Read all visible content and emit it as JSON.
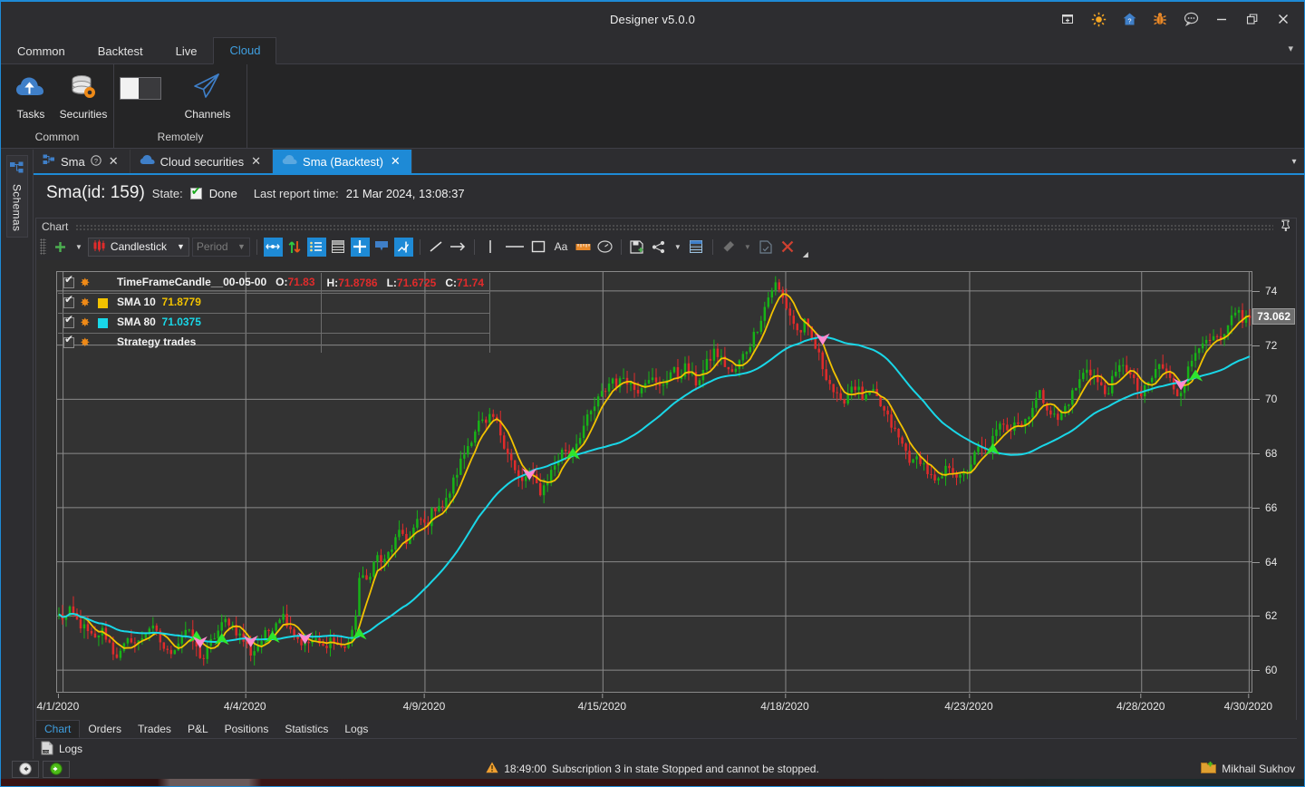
{
  "window": {
    "title": "Designer v5.0.0",
    "icons": [
      {
        "name": "new-window-icon",
        "glyph": "⊞"
      },
      {
        "name": "theme-sun-icon",
        "glyph": "☀"
      },
      {
        "name": "home-help-icon",
        "glyph": "🏠"
      },
      {
        "name": "bug-icon",
        "glyph": "🐞"
      },
      {
        "name": "chat-icon",
        "glyph": "💬"
      },
      {
        "name": "minimize-icon",
        "glyph": "—"
      },
      {
        "name": "restore-icon",
        "glyph": "❐"
      },
      {
        "name": "close-icon",
        "glyph": "✕"
      }
    ]
  },
  "ribbon": {
    "tabs": [
      {
        "label": "Common",
        "active": false
      },
      {
        "label": "Backtest",
        "active": false
      },
      {
        "label": "Live",
        "active": false
      },
      {
        "label": "Cloud",
        "active": true
      }
    ],
    "collapse_glyph": "▾",
    "groups": [
      {
        "name": "Common",
        "buttons": [
          {
            "label": "Tasks",
            "icon": "cloud-upload-icon"
          },
          {
            "label": "Securities",
            "icon": "database-gear-icon"
          }
        ]
      },
      {
        "name": "Remotely",
        "buttons": [
          {
            "label": "",
            "icon": "toggle-switch-icon"
          },
          {
            "label": "Channels",
            "icon": "paper-plane-icon"
          }
        ]
      }
    ]
  },
  "leftdock": {
    "label": "Schemas",
    "icon": "schemas-icon"
  },
  "doctabs": {
    "items": [
      {
        "label": "Sma",
        "icon": "schema-icon",
        "active": false,
        "has_help": true,
        "closable": true
      },
      {
        "label": "Cloud securities",
        "icon": "cloud-icon",
        "active": false,
        "has_help": false,
        "closable": true
      },
      {
        "label": "Sma (Backtest)",
        "icon": "cloud-icon",
        "active": true,
        "has_help": false,
        "closable": true
      }
    ],
    "overflow_glyph": "▾"
  },
  "report": {
    "id_label": "Sma(id: 159)",
    "state_label": "State:",
    "state_value": "Done",
    "report_time_label": "Last report time:",
    "report_time_value": "21 Mar 2024, 13:08:37"
  },
  "chart_panel": {
    "caption": "Chart",
    "pin_glyph": "📌",
    "toolbar": {
      "add_label": "+",
      "chart_type": "Candlestick",
      "period_placeholder": "Period",
      "buttons": [
        {
          "name": "auto-scale-icon",
          "glyph": "⟷",
          "state": "on"
        },
        {
          "name": "updown-arrows-icon",
          "glyph": "⇅",
          "state": "off"
        },
        {
          "name": "legend-list-icon",
          "glyph": "☰",
          "state": "on"
        },
        {
          "name": "data-grid-icon",
          "glyph": "▤",
          "state": "off"
        },
        {
          "name": "crosshair-icon",
          "glyph": "✛",
          "state": "on"
        },
        {
          "name": "tooltip-icon",
          "glyph": "▼",
          "state": "off"
        },
        {
          "name": "measure-icon",
          "glyph": "📐",
          "state": "on"
        },
        {
          "name": "line-tool-icon",
          "glyph": "╱",
          "state": "off"
        },
        {
          "name": "arrow-tool-icon",
          "glyph": "→",
          "state": "off"
        },
        {
          "name": "vertical-line-icon",
          "glyph": "│",
          "state": "off"
        },
        {
          "name": "horizontal-line-icon",
          "glyph": "—",
          "state": "off"
        },
        {
          "name": "rectangle-icon",
          "glyph": "▭",
          "state": "off"
        },
        {
          "name": "text-tool-icon",
          "glyph": "Aa",
          "state": "off"
        },
        {
          "name": "ruler-icon",
          "glyph": "▬",
          "state": "off"
        },
        {
          "name": "gauge-icon",
          "glyph": "◴",
          "state": "off"
        },
        {
          "name": "save-template-icon",
          "glyph": "🖫",
          "state": "off"
        },
        {
          "name": "share-icon",
          "glyph": "⦙",
          "state": "off"
        },
        {
          "name": "grid-rows-icon",
          "glyph": "▤",
          "state": "off"
        },
        {
          "name": "eraser-icon",
          "glyph": "✎",
          "state": "dim"
        },
        {
          "name": "copy-doc-icon",
          "glyph": "🗋",
          "state": "dim"
        },
        {
          "name": "delete-x-icon",
          "glyph": "✕",
          "state": "off"
        }
      ]
    }
  },
  "chart_data": {
    "type": "candlestick",
    "title": "",
    "xlabel": "",
    "ylabel": "",
    "ylim": [
      59.2,
      74.7
    ],
    "yticks": [
      74,
      72,
      70,
      68,
      66,
      64,
      62,
      60
    ],
    "grid": true,
    "xticks": [
      {
        "label": "4/1/2020",
        "pos": 0.005
      },
      {
        "label": "4/4/2020",
        "pos": 0.158
      },
      {
        "label": "4/9/2020",
        "pos": 0.308
      },
      {
        "label": "4/15/2020",
        "pos": 0.457
      },
      {
        "label": "4/18/2020",
        "pos": 0.61
      },
      {
        "label": "4/23/2020",
        "pos": 0.764
      },
      {
        "label": "4/28/2020",
        "pos": 0.908
      },
      {
        "label": "4/30/2020",
        "pos": 0.998
      }
    ],
    "last_price_label": "73.062",
    "last_price": 73.062,
    "legend_position": "top-left",
    "series": [
      {
        "name": "TimeFrameCandle__00-05-00",
        "type": "candlestick",
        "up_color": "#17b317",
        "down_color": "#e02b2b",
        "ohlc": {
          "O": "71.83",
          "H": "71.8786",
          "L": "71.6725",
          "C": "71.74"
        }
      },
      {
        "name": "SMA 10",
        "type": "line",
        "color": "#f2c200",
        "value": "71.8779"
      },
      {
        "name": "SMA 80",
        "type": "line",
        "color": "#19d7e8",
        "value": "71.0375"
      },
      {
        "name": "Strategy trades",
        "type": "markers",
        "buy_color": "#2ee62e",
        "sell_color": "#ff8ad0"
      }
    ],
    "price_path": [
      62.0,
      61.9,
      62.2,
      61.8,
      61.6,
      61.3,
      61.1,
      61.5,
      61.2,
      60.7,
      60.5,
      60.9,
      61.2,
      60.9,
      61.3,
      61.6,
      61.4,
      61.0,
      60.6,
      60.8,
      61.1,
      61.5,
      61.2,
      60.7,
      60.4,
      60.9,
      61.3,
      61.6,
      61.9,
      61.6,
      61.3,
      61.0,
      60.6,
      60.9,
      61.2,
      61.5,
      61.8,
      62.1,
      61.8,
      61.4,
      61.1,
      60.9,
      61.1,
      61.0,
      60.8,
      61.2,
      61.0,
      60.8,
      61.0,
      61.4,
      63.5,
      63.2,
      63.8,
      64.2,
      63.9,
      64.4,
      64.8,
      65.1,
      64.7,
      65.2,
      65.6,
      65.3,
      65.8,
      66.2,
      66.0,
      66.6,
      67.2,
      67.8,
      68.3,
      68.8,
      69.2,
      69.0,
      69.4,
      69.0,
      68.4,
      67.9,
      67.2,
      66.9,
      67.3,
      67.0,
      66.6,
      66.9,
      67.4,
      67.8,
      68.2,
      68.0,
      68.4,
      68.9,
      69.3,
      69.7,
      70.1,
      70.4,
      70.8,
      70.5,
      70.9,
      70.6,
      70.3,
      70.6,
      70.9,
      70.6,
      70.4,
      70.8,
      71.1,
      70.8,
      71.2,
      70.9,
      70.6,
      71.0,
      71.4,
      71.8,
      71.5,
      71.2,
      70.9,
      71.3,
      71.7,
      72.1,
      72.6,
      73.2,
      73.8,
      74.3,
      73.9,
      73.4,
      72.9,
      72.4,
      72.8,
      72.3,
      71.8,
      71.2,
      70.7,
      70.2,
      69.8,
      70.2,
      70.6,
      70.3,
      69.9,
      70.3,
      70.0,
      69.6,
      69.2,
      68.8,
      68.4,
      68.0,
      67.6,
      67.9,
      67.5,
      67.1,
      66.8,
      67.2,
      67.6,
      67.3,
      67.0,
      67.4,
      67.8,
      68.2,
      68.0,
      68.4,
      68.8,
      69.2,
      68.9,
      69.3,
      69.0,
      69.4,
      69.8,
      70.2,
      69.9,
      69.5,
      69.2,
      69.6,
      70.0,
      70.4,
      70.8,
      71.2,
      70.9,
      70.5,
      70.2,
      70.6,
      71.0,
      71.4,
      70.9,
      70.5,
      70.1,
      70.5,
      70.9,
      71.3,
      71.0,
      70.6,
      70.2,
      70.6,
      71.2,
      71.8,
      72.3,
      71.9,
      72.3,
      72.0,
      72.4,
      72.9,
      73.3,
      72.9,
      73.062
    ]
  },
  "bottom": {
    "tabs": [
      {
        "label": "Chart",
        "active": true
      },
      {
        "label": "Orders",
        "active": false
      },
      {
        "label": "Trades",
        "active": false
      },
      {
        "label": "P&L",
        "active": false
      },
      {
        "label": "Positions",
        "active": false
      },
      {
        "label": "Statistics",
        "active": false
      },
      {
        "label": "Logs",
        "active": false
      }
    ],
    "logs_label": "Logs",
    "logs_icon": "logs-file-icon"
  },
  "statusbar": {
    "back_glyph": "◀",
    "forward_glyph": "▶",
    "message_time": "18:49:00",
    "message_text": "Subscription 3 in state Stopped and cannot be stopped.",
    "user_name": "Mikhail Sukhov",
    "user_icon": "user-folder-icon"
  }
}
